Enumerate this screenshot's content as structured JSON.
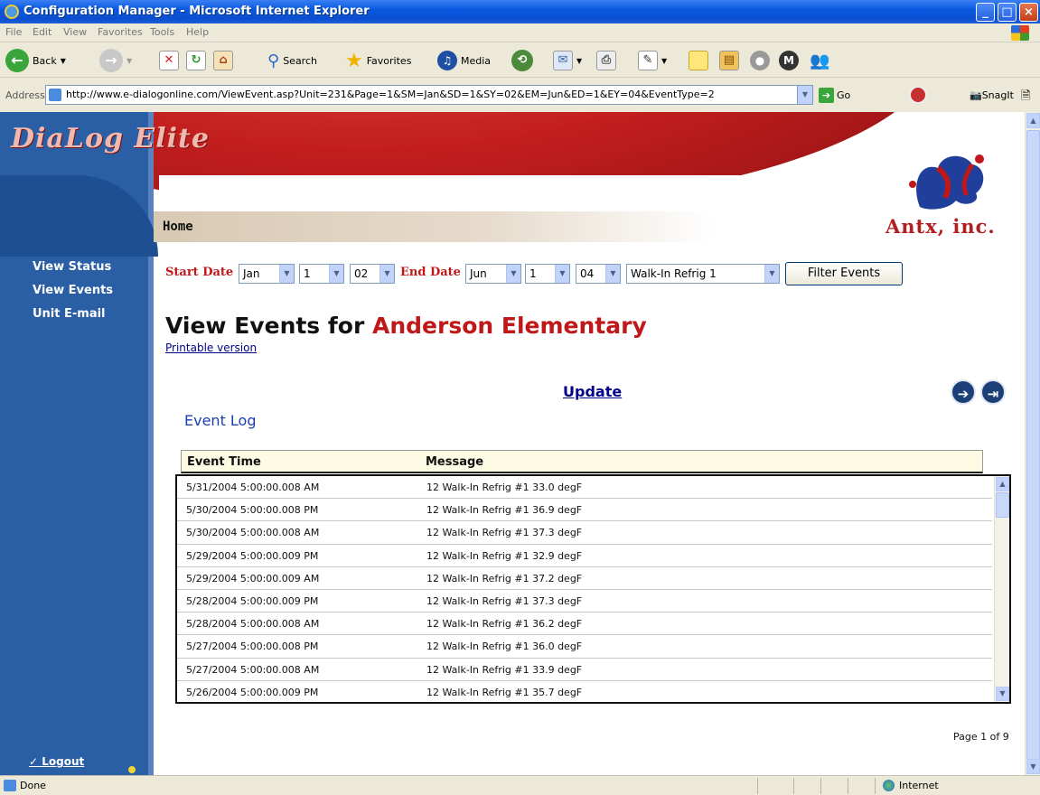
{
  "window": {
    "title": "Configuration Manager - Microsoft Internet Explorer"
  },
  "menu": {
    "items": [
      "File",
      "Edit",
      "View",
      "Favorites",
      "Tools",
      "Help"
    ]
  },
  "toolbar": {
    "back": "Back",
    "search": "Search",
    "favorites": "Favorites",
    "media": "Media"
  },
  "address": {
    "label": "Address",
    "url": "http://www.e-dialogonline.com/ViewEvent.asp?Unit=231&Page=1&SM=Jan&SD=1&SY=02&EM=Jun&ED=1&EY=04&EventType=2",
    "go": "Go",
    "snagit": "SnagIt"
  },
  "site": {
    "brand": "DiaLog Elite",
    "home": "Home",
    "logo_text": "Antx, inc.",
    "nav": [
      "View Status",
      "View Events",
      "Unit E-mail"
    ],
    "logout": "Logout"
  },
  "filter": {
    "start_label": "Start Date",
    "start_month": "Jan",
    "start_day": "1",
    "start_year": "02",
    "end_label": "End Date",
    "end_month": "Jun",
    "end_day": "1",
    "end_year": "04",
    "unit": "Walk-In Refrig 1",
    "button": "Filter Events"
  },
  "page": {
    "title_prefix": "View Events for",
    "school": "Anderson Elementary",
    "printable": "Printable version",
    "update": "Update",
    "eventlog": "Event Log",
    "pagination": "Page 1 of 9"
  },
  "table": {
    "headers": [
      "Event Time",
      "Message"
    ],
    "rows": [
      [
        "5/31/2004 5:00:00.008 AM",
        "12 Walk-In Refrig #1 33.0 degF"
      ],
      [
        "5/30/2004 5:00:00.008 PM",
        "12 Walk-In Refrig #1 36.9 degF"
      ],
      [
        "5/30/2004 5:00:00.008 AM",
        "12 Walk-In Refrig #1 37.3 degF"
      ],
      [
        "5/29/2004 5:00:00.009 PM",
        "12 Walk-In Refrig #1 32.9 degF"
      ],
      [
        "5/29/2004 5:00:00.009 AM",
        "12 Walk-In Refrig #1 37.2 degF"
      ],
      [
        "5/28/2004 5:00:00.009 PM",
        "12 Walk-In Refrig #1 37.3 degF"
      ],
      [
        "5/28/2004 5:00:00.008 AM",
        "12 Walk-In Refrig #1 36.2 degF"
      ],
      [
        "5/27/2004 5:00:00.008 PM",
        "12 Walk-In Refrig #1 36.0 degF"
      ],
      [
        "5/27/2004 5:00:00.008 AM",
        "12 Walk-In Refrig #1 33.9 degF"
      ],
      [
        "5/26/2004 5:00:00.009 PM",
        "12 Walk-In Refrig #1 35.7 degF"
      ]
    ]
  },
  "status": {
    "text": "Done",
    "zone": "Internet"
  }
}
